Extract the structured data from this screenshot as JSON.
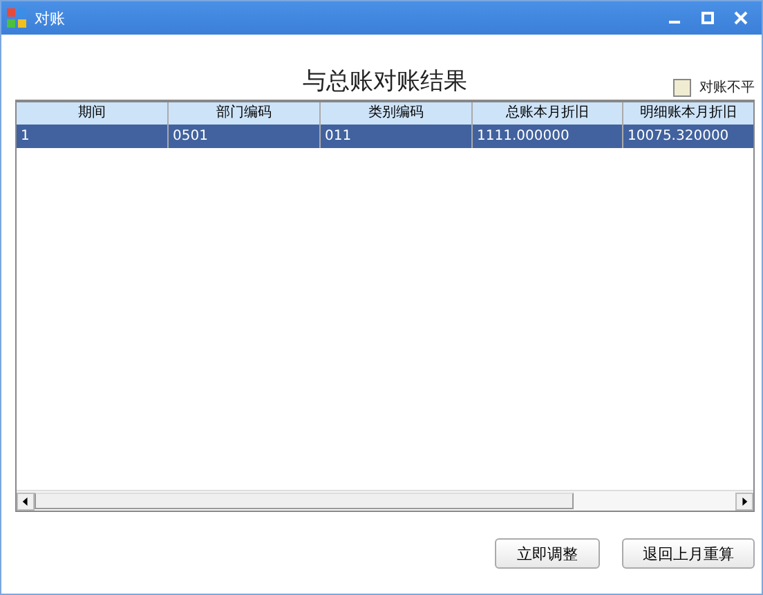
{
  "window": {
    "title": "对账"
  },
  "heading": "与总账对账结果",
  "legend": {
    "label": "对账不平",
    "color": "#f0ecd2"
  },
  "table": {
    "columns": [
      "期间",
      "部门编码",
      "类别编码",
      "总账本月折旧",
      "明细账本月折旧"
    ],
    "rows": [
      {
        "cells": [
          "1",
          "0501",
          "011",
          "1111.000000",
          "10075.320000"
        ],
        "selected": true
      }
    ]
  },
  "buttons": [
    "立即调整",
    "退回上月重算"
  ]
}
